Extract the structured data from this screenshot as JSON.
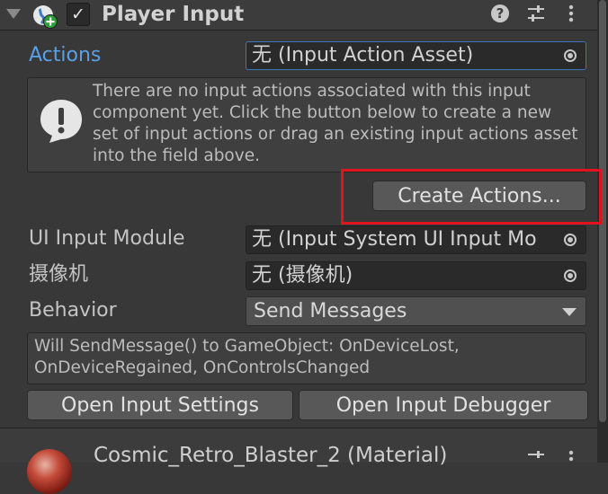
{
  "component": {
    "title": "Player Input",
    "enabled": true,
    "icons": [
      "player-input-component-icon",
      "help-icon",
      "preset-icon",
      "more-menu-icon"
    ]
  },
  "actions": {
    "label": "Actions",
    "value": "无 (Input Action Asset)"
  },
  "help_box": {
    "text": "There are no input actions associated with this input component yet. Click the button below to create a new set of input actions or drag an existing input actions asset into the field above."
  },
  "create_actions_button": "Create Actions...",
  "ui_input_module": {
    "label": "UI Input Module",
    "value": "无 (Input System UI Input Mo"
  },
  "camera": {
    "label": "摄像机",
    "value": "无 (摄像机)"
  },
  "behavior": {
    "label": "Behavior",
    "value": "Send Messages"
  },
  "info_box": {
    "text": "Will SendMessage() to GameObject: OnDeviceLost, OnDeviceRegained, OnControlsChanged"
  },
  "buttons": {
    "open_input_settings": "Open Input Settings",
    "open_input_debugger": "Open Input Debugger"
  },
  "next_component": {
    "title": "Cosmic_Retro_Blaster_2 (Material)"
  },
  "colors": {
    "background": "#383838",
    "highlight": "#e0141e",
    "field": "#2a2a2a",
    "button": "#585858",
    "actions_label": "#5aa0e6"
  }
}
